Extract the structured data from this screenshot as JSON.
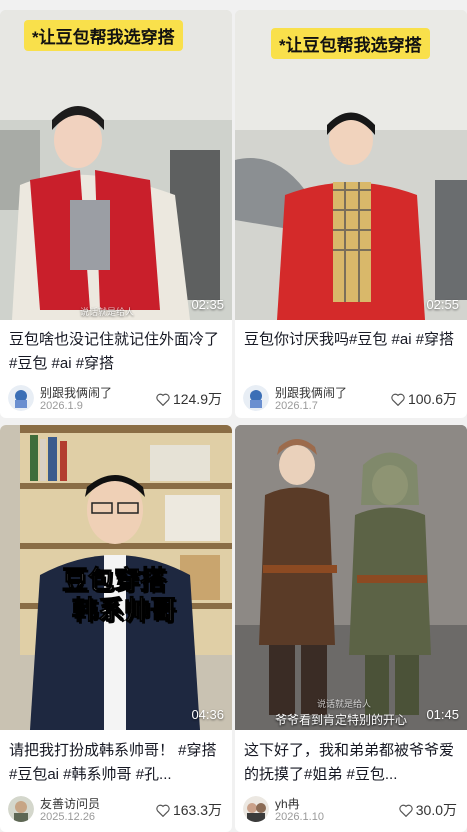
{
  "videos": [
    {
      "caption": "*让豆包帮我选穿搭",
      "duration": "02:35",
      "title": "豆包啥也没记住就记住外面冷了#豆包 #ai #穿搭",
      "author": "别跟我俩闹了",
      "date": "2026.1.9",
      "likes": "124.9万",
      "watermark": "说话就是给人"
    },
    {
      "caption": "*让豆包帮我选穿搭",
      "duration": "02:55",
      "title": "豆包你讨厌我吗#豆包 #ai #穿搭",
      "author": "别跟我俩闹了",
      "date": "2026.1.7",
      "likes": "100.6万"
    },
    {
      "overlay_line1": "豆包穿搭",
      "overlay_line2": "韩系帅哥",
      "duration": "04:36",
      "title": "请把我打扮成韩系帅哥！ #穿搭 #豆包ai #韩系帅哥 #孔...",
      "author": "友善访问员",
      "date": "2025.12.26",
      "likes": "163.3万"
    },
    {
      "subtitle": "爷爷看到肯定特别的开心",
      "watermark": "说话就是给人",
      "duration": "01:45",
      "title": "这下好了，我和弟弟都被爷爷爱的抚摸了#姐弟 #豆包...",
      "author": "yh冉",
      "date": "2026.1.10",
      "likes": "30.0万"
    }
  ],
  "colors": {
    "badge": "#f9e04b",
    "red_jacket": "#d42a2a",
    "background": "#f1f1f1"
  }
}
